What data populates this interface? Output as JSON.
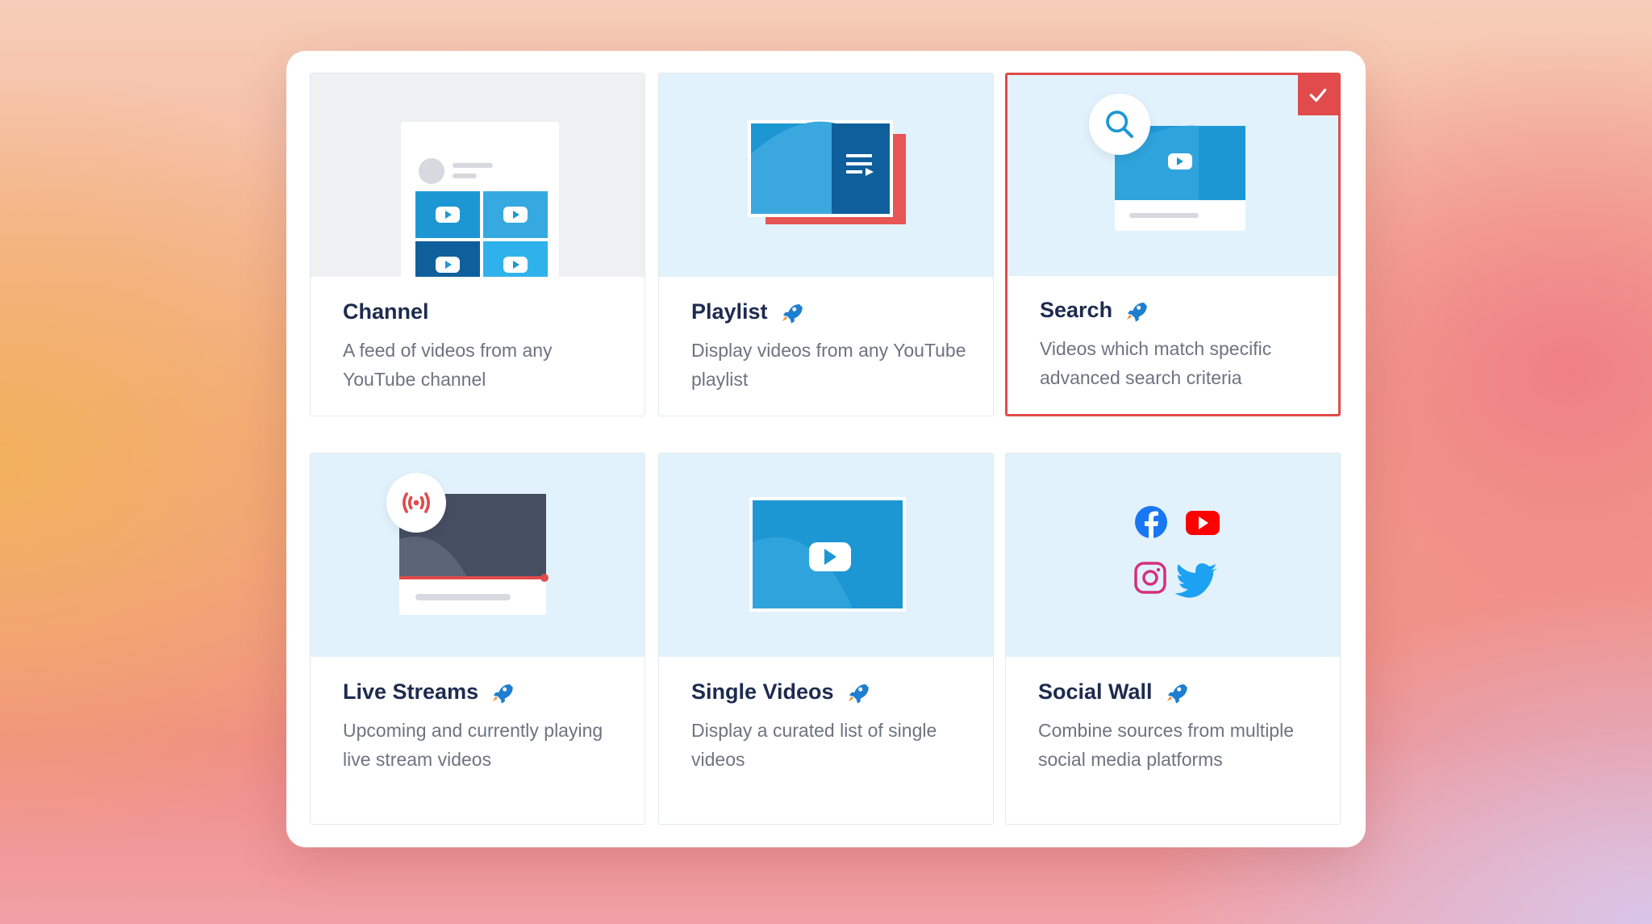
{
  "cards": [
    {
      "title": "Channel",
      "desc": "A feed of videos from any YouTube channel",
      "rocket": false
    },
    {
      "title": "Playlist",
      "desc": "Display videos from any YouTube playlist",
      "rocket": true
    },
    {
      "title": "Search",
      "desc": "Videos which match specific advanced search criteria",
      "rocket": true,
      "selected": true
    },
    {
      "title": "Live Streams",
      "desc": "Upcoming and currently playing live stream videos",
      "rocket": true
    },
    {
      "title": "Single Videos",
      "desc": "Display a curated list of single videos",
      "rocket": true
    },
    {
      "title": "Social Wall",
      "desc": "Combine sources from multiple social media platforms",
      "rocket": true
    }
  ],
  "icons": {
    "rocket": "rocket-icon",
    "selected_badge": "checkmark-icon",
    "search": "search-icon",
    "live": "broadcast-icon",
    "social": [
      "facebook-icon",
      "youtube-icon",
      "instagram-icon",
      "twitter-icon"
    ]
  },
  "colors": {
    "accent_red": "#e14b4b",
    "title_navy": "#1d2b4f",
    "illustration_bg": "#e1f2fd",
    "video_blue": "#1d97d4",
    "rocket_blue": "#1e7fd0"
  }
}
